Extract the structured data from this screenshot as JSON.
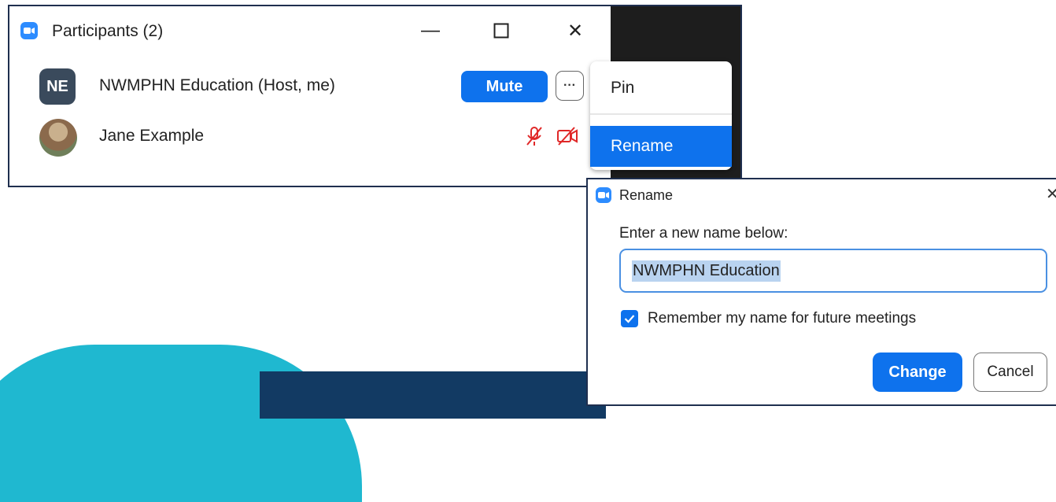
{
  "participants_window": {
    "title": "Participants (2)",
    "minimize_glyph": "—",
    "maximize_glyph": "☐",
    "close_glyph": "✕",
    "participants": [
      {
        "initials": "NE",
        "name": "NWMPHN Education (Host, me)",
        "mute_label": "Mute",
        "more_label": "···"
      },
      {
        "name": "Jane Example",
        "mic_icon": "mic-muted-icon",
        "video_icon": "video-off-icon"
      }
    ]
  },
  "context_menu": {
    "items": [
      {
        "label": "Pin"
      },
      {
        "label": "Rename"
      }
    ]
  },
  "rename_dialog": {
    "title": "Rename",
    "close_glyph": "✕",
    "prompt": "Enter a new name below:",
    "name_value": "NWMPHN Education",
    "remember_checked": true,
    "remember_label": "Remember my name for future meetings",
    "change_label": "Change",
    "cancel_label": "Cancel"
  },
  "colors": {
    "accent": "#0e72ed",
    "teal": "#1fb8d0",
    "navy": "#123a63",
    "muted_red": "#e02828"
  }
}
